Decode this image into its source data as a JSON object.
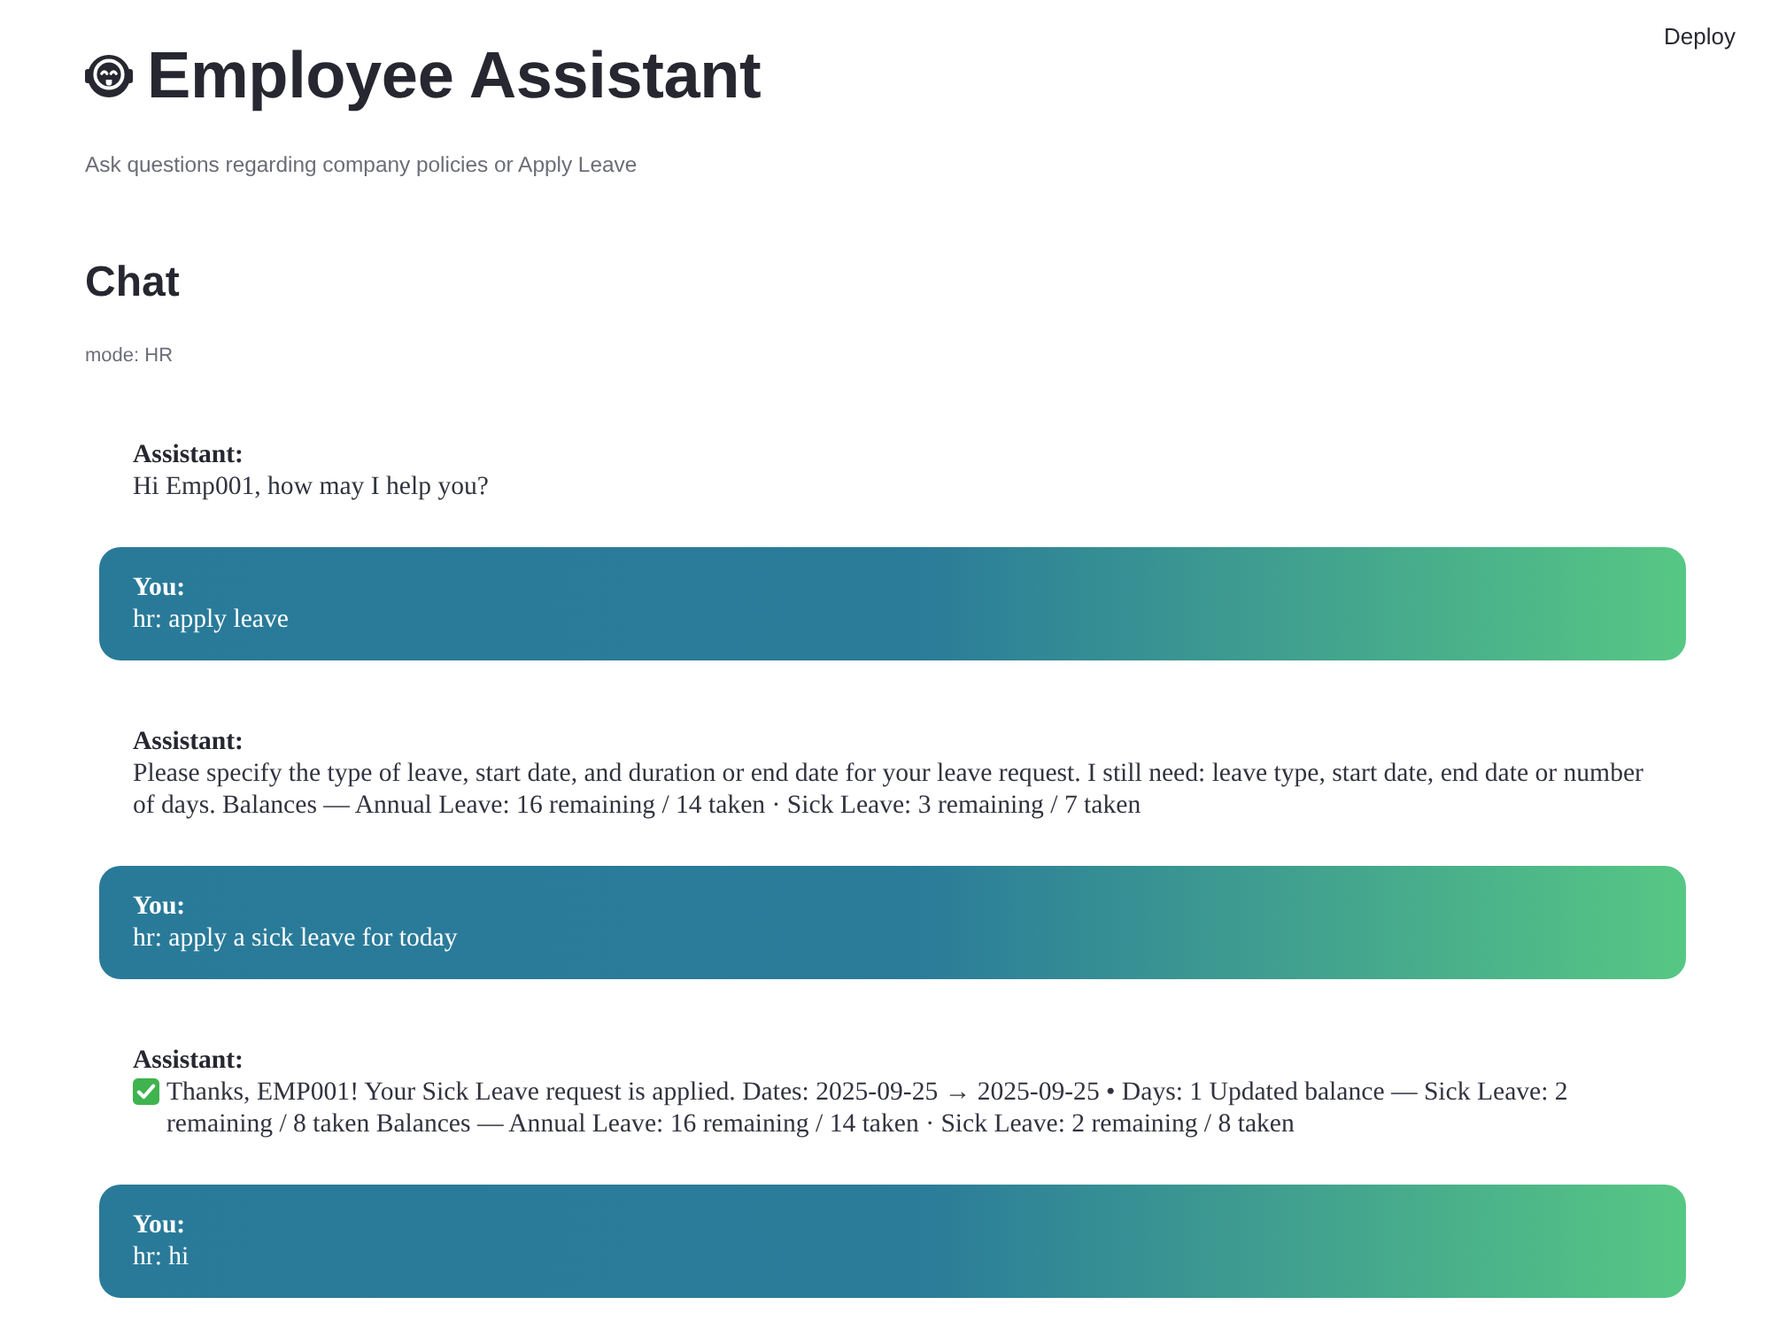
{
  "header": {
    "deploy_button": "Deploy"
  },
  "title": "Employee Assistant",
  "subtitle": "Ask questions regarding company policies or Apply Leave",
  "chat": {
    "heading": "Chat",
    "mode": "mode: HR",
    "messages": [
      {
        "kind": "assistant",
        "sender": "Assistant:",
        "text": "Hi Emp001, how may I help you?"
      },
      {
        "kind": "user",
        "sender": "You:",
        "text": "hr: apply leave"
      },
      {
        "kind": "assistant",
        "sender": "Assistant:",
        "text": "Please specify the type of leave, start date, and duration or end date for your leave request. I still need: leave type, start date, end date or number of days. Balances — Annual Leave: 16 remaining / 14 taken · Sick Leave: 3 remaining / 7 taken"
      },
      {
        "kind": "user",
        "sender": "You:",
        "text": "hr: apply a sick leave for today"
      },
      {
        "kind": "confirmation",
        "sender": "Assistant:",
        "text": "Thanks, EMP001! Your Sick Leave request is applied. Dates: 2025-09-25 → 2025-09-25 • Days: 1 Updated balance — Sick Leave: 2 remaining / 8 taken Balances — Annual Leave: 16 remaining / 14 taken · Sick Leave: 2 remaining / 8 taken"
      },
      {
        "kind": "user",
        "sender": "You:",
        "text": "hr: hi"
      }
    ]
  }
}
